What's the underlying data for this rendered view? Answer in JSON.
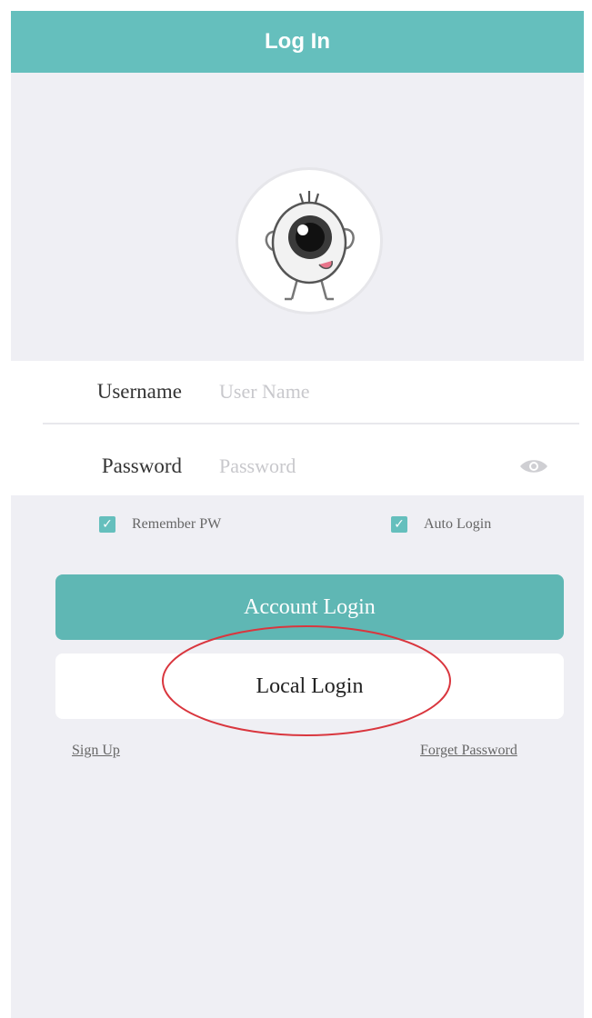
{
  "header": {
    "title": "Log In"
  },
  "avatar": {
    "icon": "eyeball-mascot-icon"
  },
  "form": {
    "username_label": "Username",
    "username_placeholder": "User Name",
    "username_value": "",
    "password_label": "Password",
    "password_placeholder": "Password",
    "password_value": "",
    "password_toggle_icon": "eye-icon"
  },
  "options": {
    "remember_label": "Remember PW",
    "remember_checked": true,
    "auto_login_label": "Auto Login",
    "auto_login_checked": true
  },
  "actions": {
    "account_login_label": "Account Login",
    "local_login_label": "Local Login"
  },
  "links": {
    "sign_up": "Sign Up",
    "forget_password": "Forget Password"
  },
  "colors": {
    "accent": "#65bfbd",
    "button": "#5fb7b4",
    "background": "#efeff4",
    "annotation": "#d9363e"
  }
}
